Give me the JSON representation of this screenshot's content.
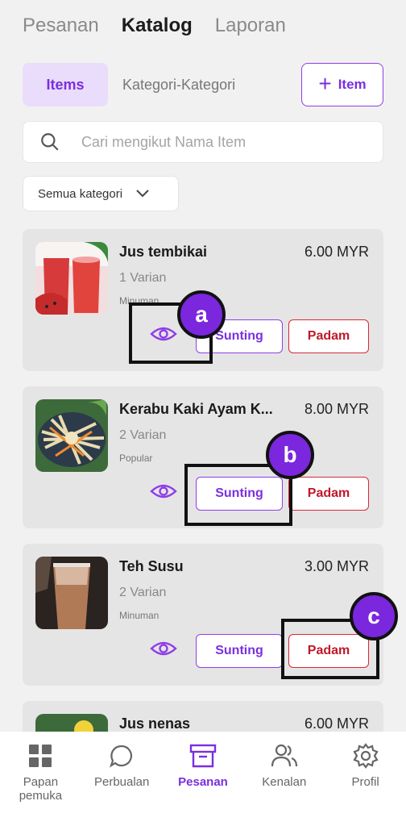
{
  "top_tabs": [
    "Pesanan",
    "Katalog",
    "Laporan"
  ],
  "segments": {
    "items": "Items",
    "categories": "Kategori-Kategori"
  },
  "add_button": "Item",
  "search": {
    "placeholder": "Cari mengikut Nama Item"
  },
  "filter": {
    "selected": "Semua kategori"
  },
  "items": [
    {
      "name": "Jus tembikai",
      "price": "6.00 MYR",
      "variants": "1 Varian",
      "category": "Minuman",
      "edit": "Sunting",
      "delete": "Padam"
    },
    {
      "name": "Kerabu Kaki Ayam K...",
      "price": "8.00 MYR",
      "variants": "2 Varian",
      "category": "Popular",
      "edit": "Sunting",
      "delete": "Padam"
    },
    {
      "name": "Teh Susu",
      "price": "3.00 MYR",
      "variants": "2 Varian",
      "category": "Minuman",
      "edit": "Sunting",
      "delete": "Padam"
    },
    {
      "name": "Jus nenas",
      "price": "6.00 MYR"
    }
  ],
  "callouts": [
    "a",
    "b",
    "c"
  ],
  "bottom_nav": [
    {
      "label": "Papan pemuka",
      "icon": "dashboard-icon"
    },
    {
      "label": "Perbualan",
      "icon": "chat-icon"
    },
    {
      "label": "Pesanan",
      "icon": "archive-icon"
    },
    {
      "label": "Kenalan",
      "icon": "contacts-icon"
    },
    {
      "label": "Profil",
      "icon": "gear-icon"
    }
  ],
  "colors": {
    "accent": "#7a2fe0",
    "danger": "#d8283a",
    "card": "#e6e5e6"
  }
}
